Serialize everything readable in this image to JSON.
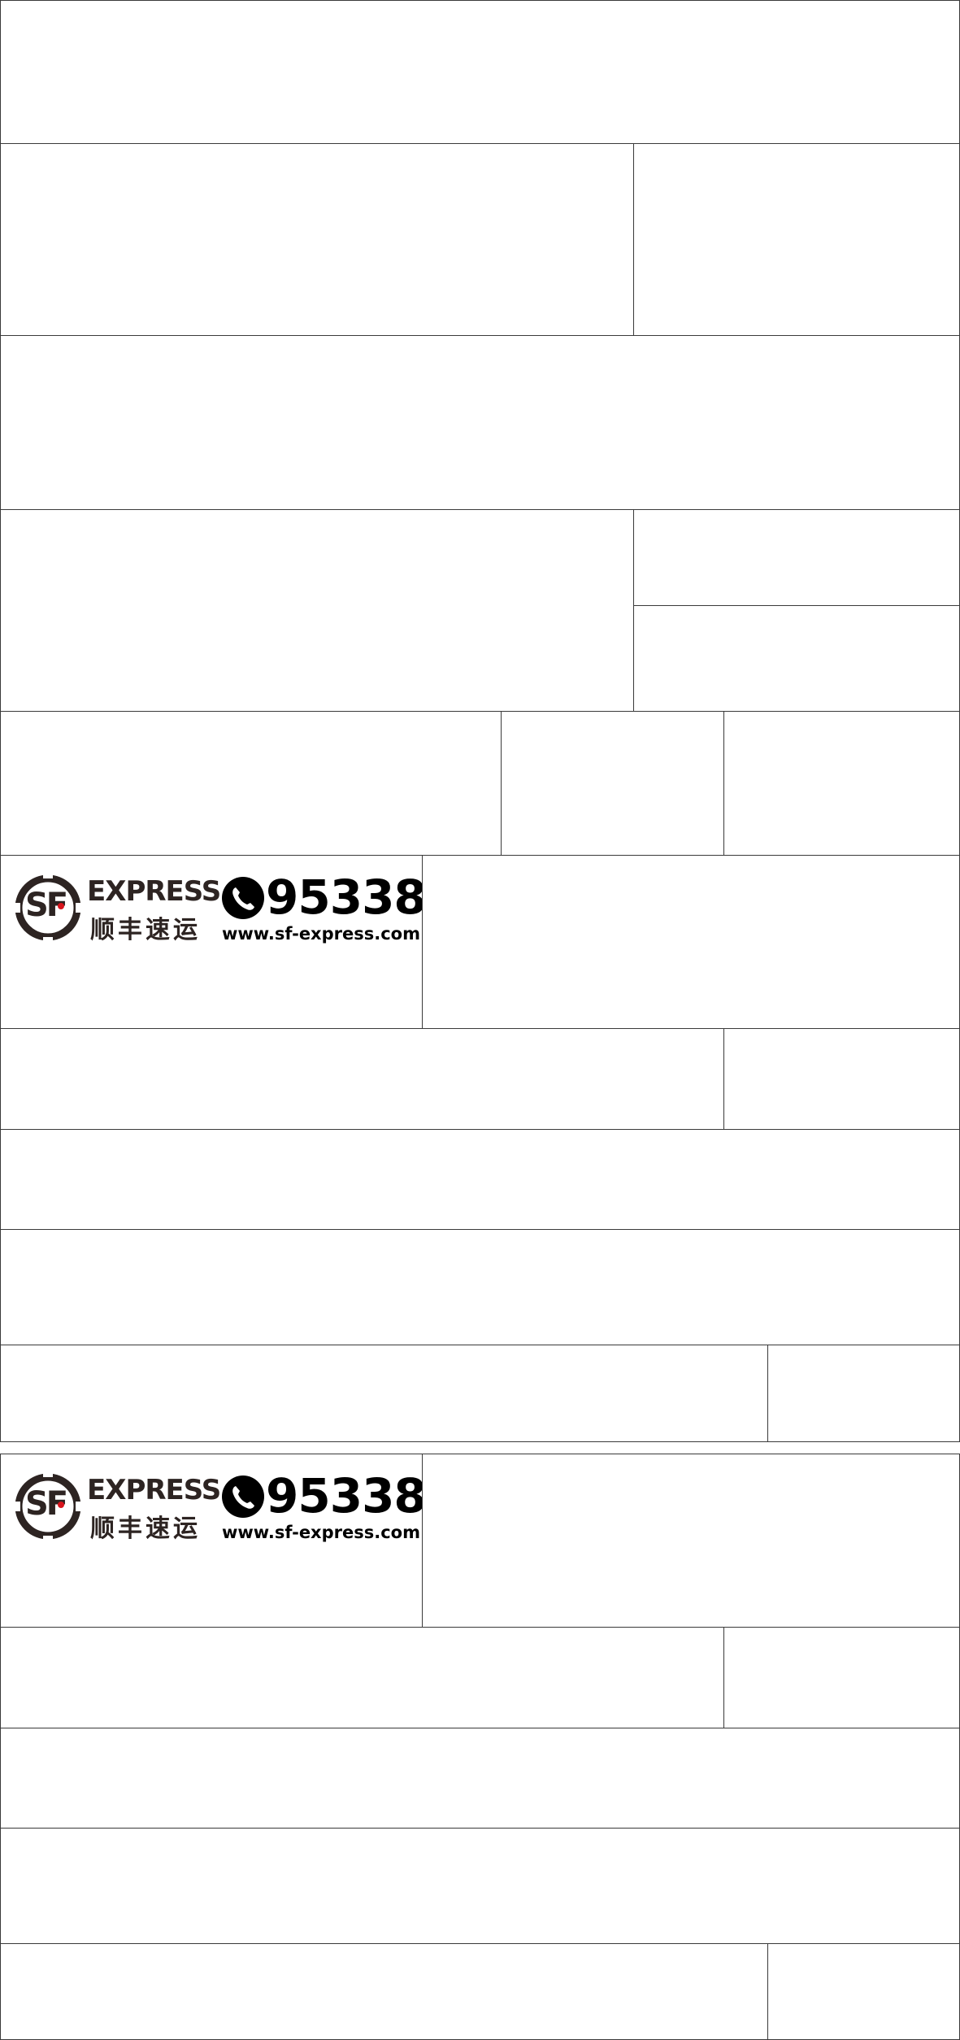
{
  "brand": {
    "express": "EXPRESS",
    "cn_name": "顺丰速运",
    "monogram": "SF",
    "phone": "95338",
    "website": "www.sf-express.com",
    "colors": {
      "ink": "#2d2422",
      "accent_red": "#d8141c",
      "border": "#3a3a3a"
    },
    "icons": [
      "sf-logo-icon",
      "phone-icon"
    ]
  }
}
